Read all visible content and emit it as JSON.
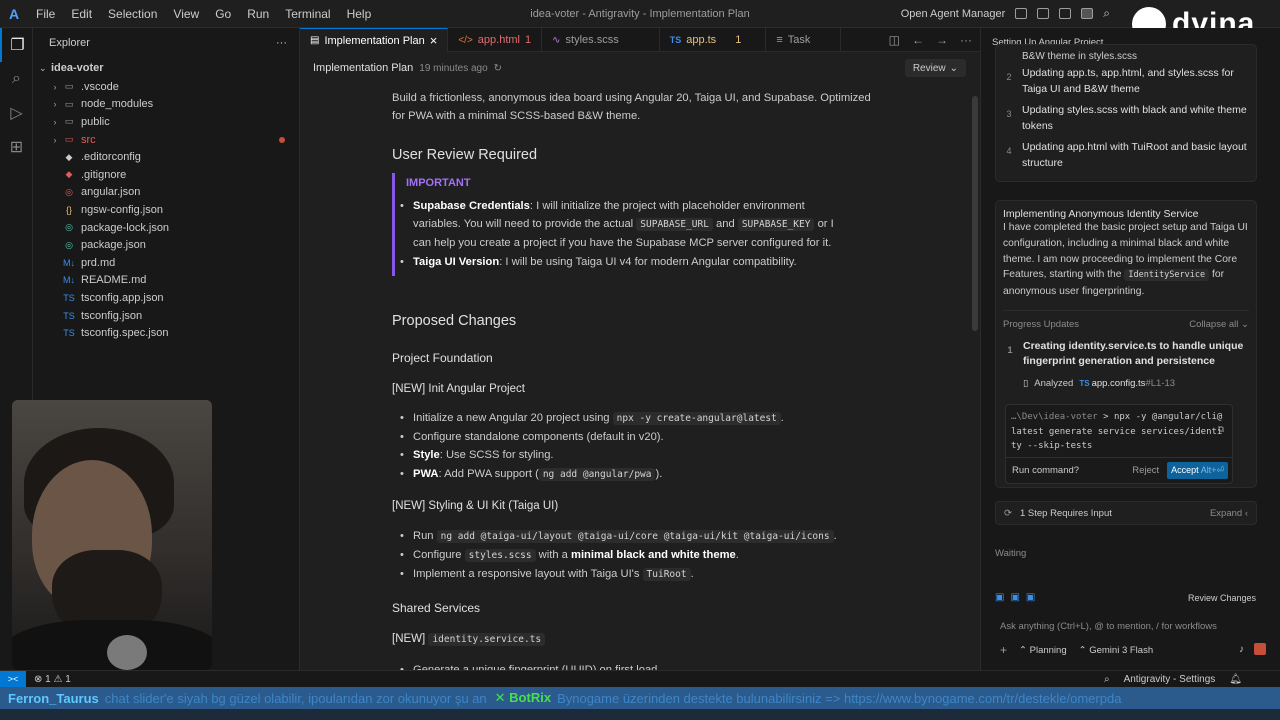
{
  "titlebar": {
    "logo": "A",
    "menu": [
      "File",
      "Edit",
      "Selection",
      "View",
      "Go",
      "Run",
      "Terminal",
      "Help"
    ],
    "window_title": "idea-voter - Antigravity - Implementation Plan",
    "open_agent_manager": "Open Agent Manager"
  },
  "activity": {
    "icons": [
      "explorer-icon",
      "search-icon",
      "run-debug-icon",
      "extensions-icon"
    ]
  },
  "sidebar": {
    "header": "Explorer",
    "more": "···",
    "root": "idea-voter",
    "items": [
      {
        "label": ".vscode",
        "kind": "folder"
      },
      {
        "label": "node_modules",
        "kind": "folder"
      },
      {
        "label": "public",
        "kind": "folder"
      },
      {
        "label": "src",
        "kind": "folder",
        "error": true
      },
      {
        "label": ".editorconfig",
        "kind": "file"
      },
      {
        "label": ".gitignore",
        "kind": "file"
      },
      {
        "label": "angular.json",
        "kind": "file"
      },
      {
        "label": "ngsw-config.json",
        "kind": "file"
      },
      {
        "label": "package-lock.json",
        "kind": "file"
      },
      {
        "label": "package.json",
        "kind": "file"
      },
      {
        "label": "prd.md",
        "kind": "file"
      },
      {
        "label": "README.md",
        "kind": "file"
      },
      {
        "label": "tsconfig.app.json",
        "kind": "file"
      },
      {
        "label": "tsconfig.json",
        "kind": "file"
      },
      {
        "label": "tsconfig.spec.json",
        "kind": "file"
      }
    ]
  },
  "tabs": [
    {
      "label": "Implementation Plan",
      "close": "×",
      "active": true
    },
    {
      "label": "app.html",
      "errors": "1",
      "icon": "</>"
    },
    {
      "label": "styles.scss",
      "icon": "scss"
    },
    {
      "label": "app.ts",
      "errors": "1",
      "icon": "TS"
    },
    {
      "label": "Task",
      "icon": "≡"
    }
  ],
  "crumb": {
    "title": "Implementation Plan",
    "ago": "19 minutes ago",
    "review": "Review"
  },
  "doc": {
    "intro_1": "Build a frictionless, anonymous idea board using Angular 20, Taiga UI, and Supabase. Optimized",
    "intro_2": "for PWA with a minimal SCSS-based B&W theme.",
    "user_review_heading": "User Review Required",
    "important_label": "IMPORTANT",
    "supabase_title": "Supabase Credentials",
    "supabase_text_1": ": I will initialize the project with placeholder environment",
    "supabase_text_2": "variables. You will need to provide the actual",
    "supabase_url": "SUPABASE_URL",
    "and": "and",
    "supabase_key": "SUPABASE_KEY",
    "or_i": "or I",
    "supabase_text_3": "can help you create a project if you have the Supabase MCP server configured for it.",
    "taiga_title": "Taiga UI Version",
    "taiga_text": ": I will be using Taiga UI v4 for modern Angular compatibility.",
    "proposed_heading": "Proposed Changes",
    "foundation_heading": "Project Foundation",
    "init_heading": "[NEW] Init Angular Project",
    "init_items": {
      "a_pre": "Initialize a new Angular 20 project using",
      "a_code": "npx -y create-angular@latest",
      "a_post": ".",
      "b": "Configure standalone components (default in v20).",
      "c_bold": "Style",
      "c_rest": ": Use SCSS for styling.",
      "d_bold": "PWA",
      "d_rest": ": Add PWA support (",
      "d_code": "ng add @angular/pwa",
      "d_end": ")."
    },
    "styling_heading": "[NEW] Styling & UI Kit (Taiga UI)",
    "styling_items": {
      "a_pre": "Run",
      "a_code": "ng add @taiga-ui/layout @taiga-ui/core @taiga-ui/kit @taiga-ui/icons",
      "a_post": ".",
      "b_pre": "Configure",
      "b_code": "styles.scss",
      "b_mid": "with a",
      "b_bold": "minimal black and white theme",
      "b_post": ".",
      "c_pre": "Implement a responsive layout with Taiga UI's",
      "c_code": "TuiRoot",
      "c_post": "."
    },
    "shared_heading": "Shared Services",
    "new_label": "[NEW]",
    "identity_code": "identity.service.ts",
    "last_item": "Generate a unique fingerprint (UUID) on first load."
  },
  "panel": {
    "title": "Setting Up Angular Project",
    "steps_top_partial": "B&W theme in styles.scss",
    "steps": [
      {
        "n": "2",
        "text": "Updating app.ts, app.html, and styles.scss for Taiga UI and B&W theme"
      },
      {
        "n": "3",
        "text": "Updating styles.scss with black and white theme tokens"
      },
      {
        "n": "4",
        "text": "Updating app.html with TuiRoot and basic layout structure"
      }
    ],
    "identity_heading": "Implementing Anonymous Identity Service",
    "identity_body_1": "I have completed the basic project setup and Taiga UI configuration, including a minimal black and white theme. I am now proceeding to implement the Core Features, starting with the",
    "identity_code": "IdentityService",
    "identity_body_2": "for anonymous user fingerprinting.",
    "progress_label": "Progress Updates",
    "collapse_all": "Collapse all",
    "creating_n": "1",
    "creating_text": "Creating identity.service.ts to handle unique fingerprint generation and persistence",
    "analyzed": "Analyzed",
    "analyzed_file": "app.config.ts",
    "analyzed_lines": "#L1-13",
    "term_path": "…\\Dev\\idea-voter",
    "term_cmd": "npx -y @angular/cli@latest generate service services/identity --skip-tests",
    "run_command": "Run command?",
    "reject": "Reject",
    "accept": "Accept",
    "accept_kbd": "Alt+⏎",
    "requires_input": "1 Step Requires Input",
    "expand": "Expand",
    "waiting": "Waiting",
    "review_changes": "Review Changes",
    "chat_placeholder": "Ask anything (Ctrl+L), @ to mention, / for workflows",
    "mode": "Planning",
    "model": "Gemini 3 Flash"
  },
  "status": {
    "remote": "><",
    "problems": "⊗ 1  ⚠ 1",
    "settings": "Antigravity - Settings"
  },
  "ticker": {
    "user": "Ferron_Taurus",
    "message": "chat slider'e siyah bg güzel olabilir, ipoularıdan zor okunuyor şu an",
    "bot": "BotRix",
    "bot_message": "Bynogame üzerinden destekte bulunabilirsiniz => https://www.bynogame.com/tr/destekle/omerpda"
  },
  "brand": {
    "word": "dvina"
  }
}
